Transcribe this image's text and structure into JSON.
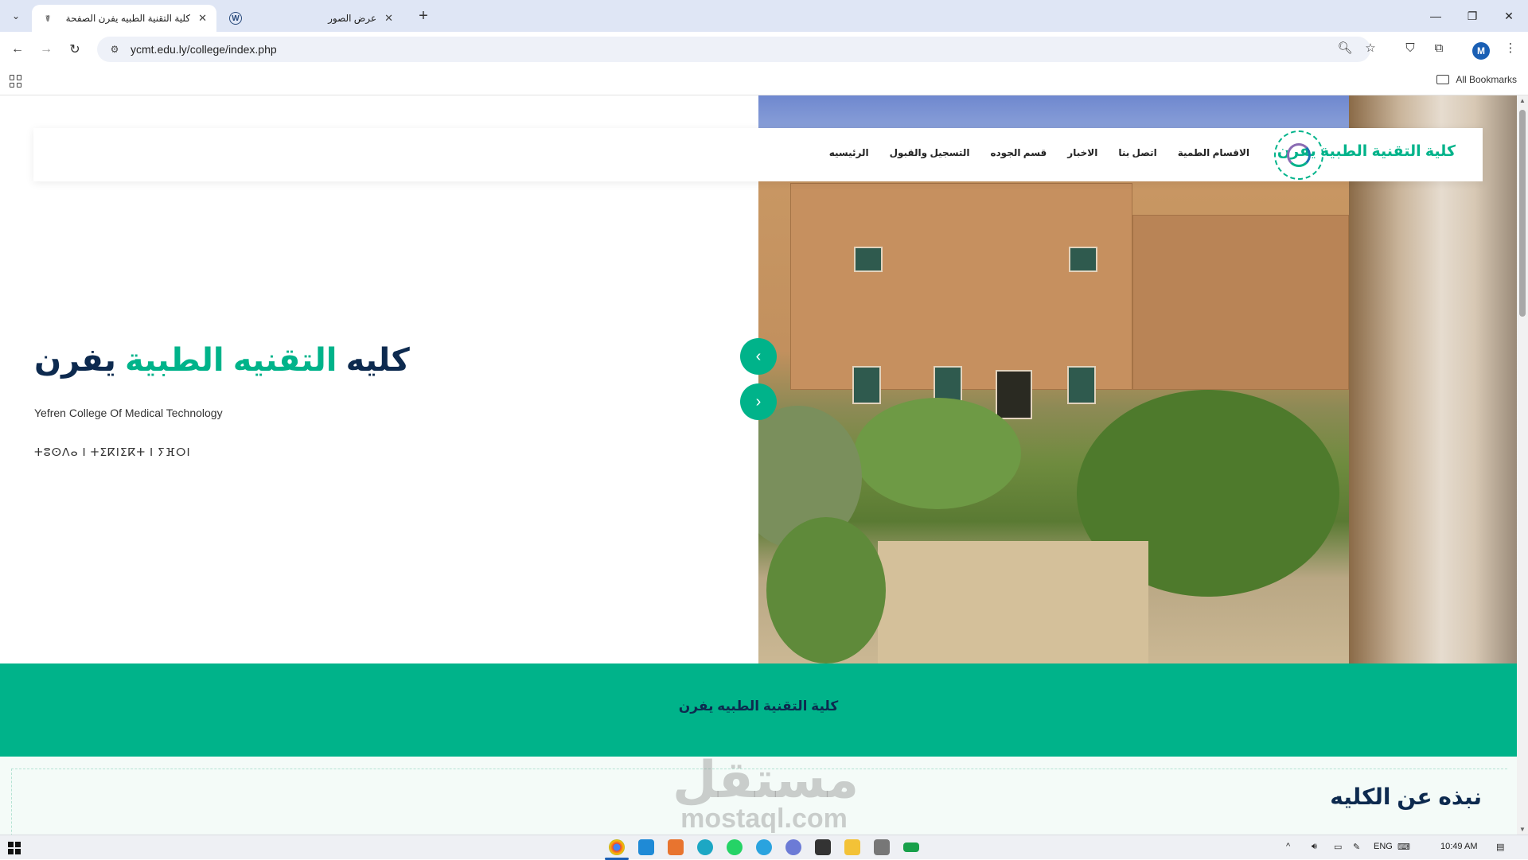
{
  "browser": {
    "tabs": [
      {
        "title": "كلية التقنية الطبيه يفرن الصفحة",
        "active": true,
        "icon": "college-favicon"
      },
      {
        "title": "عرض الصور",
        "active": false,
        "icon": "wordpress-icon"
      }
    ],
    "url": "ycmt.edu.ly/college/index.php",
    "profile_initial": "M",
    "bookmarks_label": "All Bookmarks"
  },
  "site": {
    "brand": "كلية التقنية الطبية يفرن",
    "nav": [
      "الرئيسيه",
      "التسجيل والقبول",
      "قسم الجوده",
      "الاخبار",
      "اتصل بنا",
      "الاقسام الطمية"
    ],
    "hero": {
      "title_part1": "كليه",
      "title_accent": "التقنيه الطبية",
      "title_part2": "يفرن",
      "subtitle": "Yefren College Of Medical Technology",
      "tifinagh": "ⵜⵓⵙⴷⴰ ⵏ ⵜⵉⴽⵏⵉⴽⵜ ⵏ ⵢⴼⵔⵏ"
    },
    "band_text": "كلية التقنية الطبيه يفرن",
    "below_heading": "نبذه عن الكليه"
  },
  "watermark": {
    "ar": "مستقل",
    "en": "mostaql.com"
  },
  "taskbar": {
    "lang": "ENG",
    "time": "10:49 AM"
  },
  "colors": {
    "accent": "#00b38a",
    "navy": "#0d2a4f"
  }
}
